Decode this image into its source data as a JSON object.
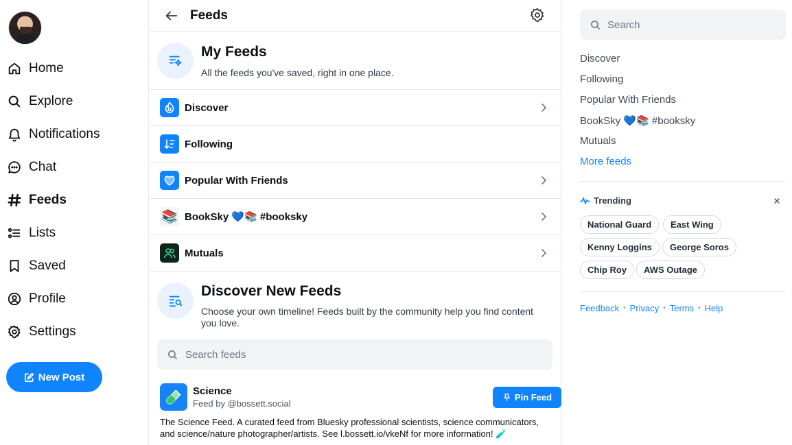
{
  "nav": {
    "items": [
      {
        "label": "Home",
        "icon": "home-icon"
      },
      {
        "label": "Explore",
        "icon": "search-icon"
      },
      {
        "label": "Notifications",
        "icon": "bell-icon"
      },
      {
        "label": "Chat",
        "icon": "chat-icon"
      },
      {
        "label": "Feeds",
        "icon": "hash-icon",
        "active": true
      },
      {
        "label": "Lists",
        "icon": "list-icon"
      },
      {
        "label": "Saved",
        "icon": "bookmark-icon"
      },
      {
        "label": "Profile",
        "icon": "profile-icon"
      },
      {
        "label": "Settings",
        "icon": "gear-icon"
      }
    ],
    "new_post_label": "New Post"
  },
  "header": {
    "title": "Feeds"
  },
  "my_feeds": {
    "title": "My Feeds",
    "subtitle": "All the feeds you've saved, right in one place.",
    "feeds": [
      {
        "label": "Discover",
        "icon": "discover-feed-icon",
        "chevron": true
      },
      {
        "label": "Following",
        "icon": "following-feed-icon",
        "chevron": false
      },
      {
        "label": "Popular With Friends",
        "icon": "heart-feed-icon",
        "chevron": true
      },
      {
        "label": "BookSky 💙📚 #booksky",
        "icon": "books-feed-icon",
        "chevron": true
      },
      {
        "label": "Mutuals",
        "icon": "mutuals-feed-icon",
        "chevron": true
      }
    ]
  },
  "discover_new": {
    "title": "Discover New Feeds",
    "subtitle": "Choose your own timeline! Feeds built by the community help you find content you love.",
    "search_placeholder": "Search feeds"
  },
  "featured_feed": {
    "name": "Science",
    "by": "Feed by @bossett.social",
    "pin_label": "Pin Feed",
    "description": "The Science Feed. A curated feed from Bluesky professional scientists,  science communicators, and science/nature photographer/artists. See l.bossett.io/vkeNf for more information! 🧪"
  },
  "right": {
    "search_placeholder": "Search",
    "links": [
      "Discover",
      "Following",
      "Popular With Friends",
      "BookSky 💙📚 #booksky",
      "Mutuals"
    ],
    "more_feeds": "More feeds",
    "trending_title": "Trending",
    "trending": [
      "National Guard",
      "East Wing",
      "Kenny Loggins",
      "George Soros",
      "Chip Roy",
      "AWS Outage"
    ],
    "footer": [
      "Feedback",
      "Privacy",
      "Terms",
      "Help"
    ]
  },
  "colors": {
    "accent": "#1083fe",
    "icon_bg": "#eaf2fd",
    "border": "#e5e7eb"
  }
}
